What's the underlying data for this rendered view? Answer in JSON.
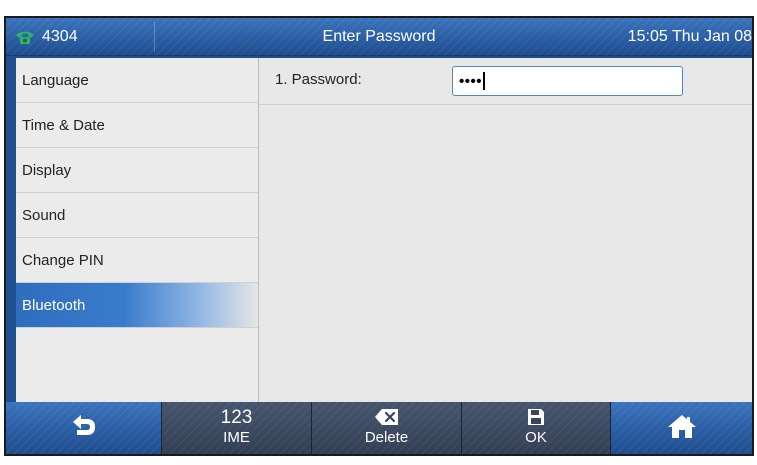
{
  "status_bar": {
    "line_number": "4304",
    "title": "Enter Password",
    "clock": "15:05 Thu Jan 08"
  },
  "sidebar": {
    "items": [
      {
        "label": "Language"
      },
      {
        "label": "Time & Date"
      },
      {
        "label": "Display"
      },
      {
        "label": "Sound"
      },
      {
        "label": "Change PIN"
      },
      {
        "label": "Bluetooth",
        "selected": true
      }
    ]
  },
  "form": {
    "password_label": "1. Password:",
    "password_masked": "••••"
  },
  "softkeys": {
    "back_icon": "back-arrow-icon",
    "ime_top": "123",
    "ime_label": "IME",
    "delete_icon": "backspace-icon",
    "delete_label": "Delete",
    "ok_icon": "save-icon",
    "ok_label": "OK",
    "home_icon": "home-icon"
  },
  "colors": {
    "header_blue": "#2a5da3",
    "selected_item": "#2f6dbd",
    "softkey_dark": "#333f54",
    "phone_icon_green": "#2fb36a"
  }
}
